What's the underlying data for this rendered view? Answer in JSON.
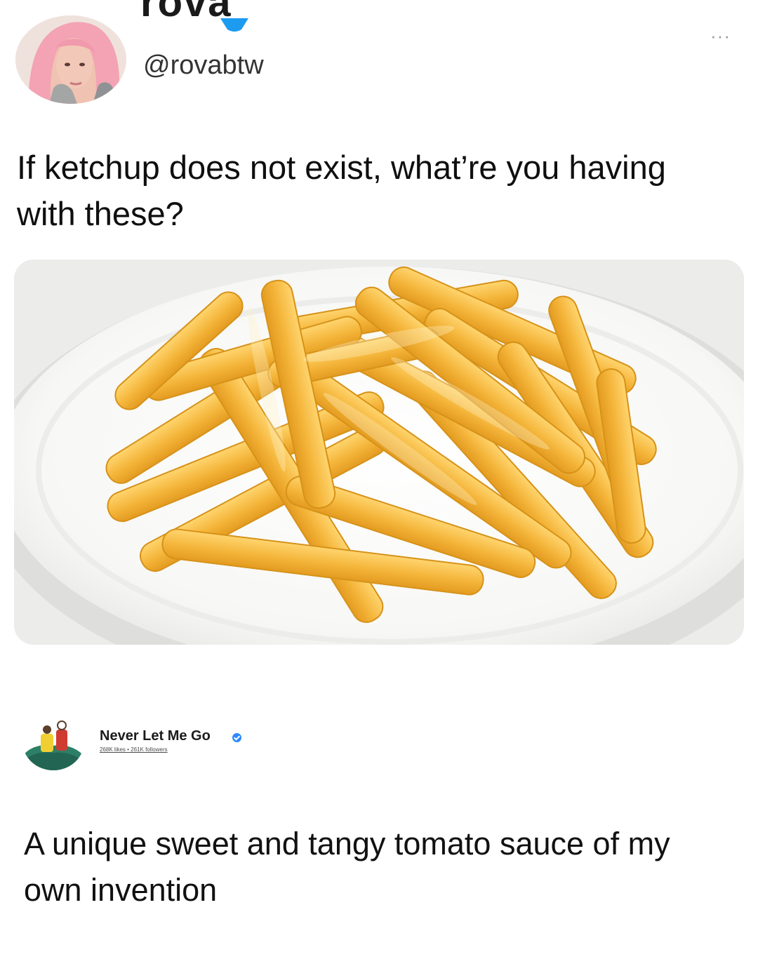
{
  "tweet": {
    "display_name": "rova",
    "handle": "@rovabtw",
    "more_label": "···",
    "text": "If ketchup does not exist, what’re you having with these?"
  },
  "page_card": {
    "name": "Never Let Me Go",
    "stats": "268K likes • 261K followers"
  },
  "reply": {
    "text": "A unique sweet and tangy tomato sauce of my own invention"
  },
  "colors": {
    "fry": "#f2b437",
    "fry_light": "#ffd671",
    "plate": "#fbfbfa",
    "verified": "#2d88ff"
  }
}
